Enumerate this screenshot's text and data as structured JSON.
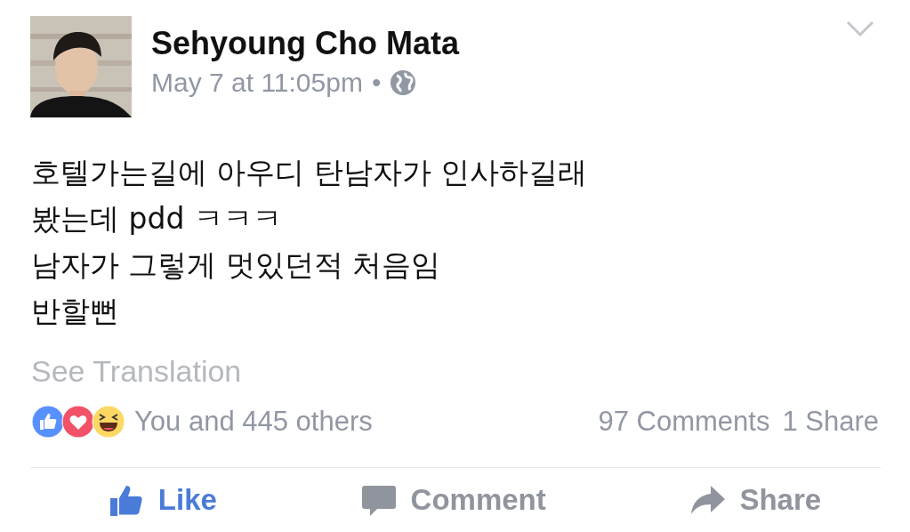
{
  "post": {
    "author": "Sehyoung Cho Mata",
    "timestamp": "May 7 at 11:05pm",
    "separator": "•",
    "body_lines": [
      "호텔가는길에 아우디 탄남자가 인사하길래",
      "봤는데 pdd ㅋㅋㅋ",
      "남자가 그렇게 멋있던적 처음임",
      "반할뻔"
    ],
    "translation_link": "See Translation"
  },
  "reactions": {
    "summary": "You and 445 others",
    "comments": "97 Comments",
    "shares": "1 Share",
    "icons": [
      {
        "kind": "like"
      },
      {
        "kind": "love"
      },
      {
        "kind": "haha"
      }
    ]
  },
  "actions": [
    {
      "kind": "like",
      "label": "Like",
      "selected": true
    },
    {
      "kind": "comment",
      "label": "Comment",
      "selected": false
    },
    {
      "kind": "share",
      "label": "Share",
      "selected": false
    }
  ]
}
